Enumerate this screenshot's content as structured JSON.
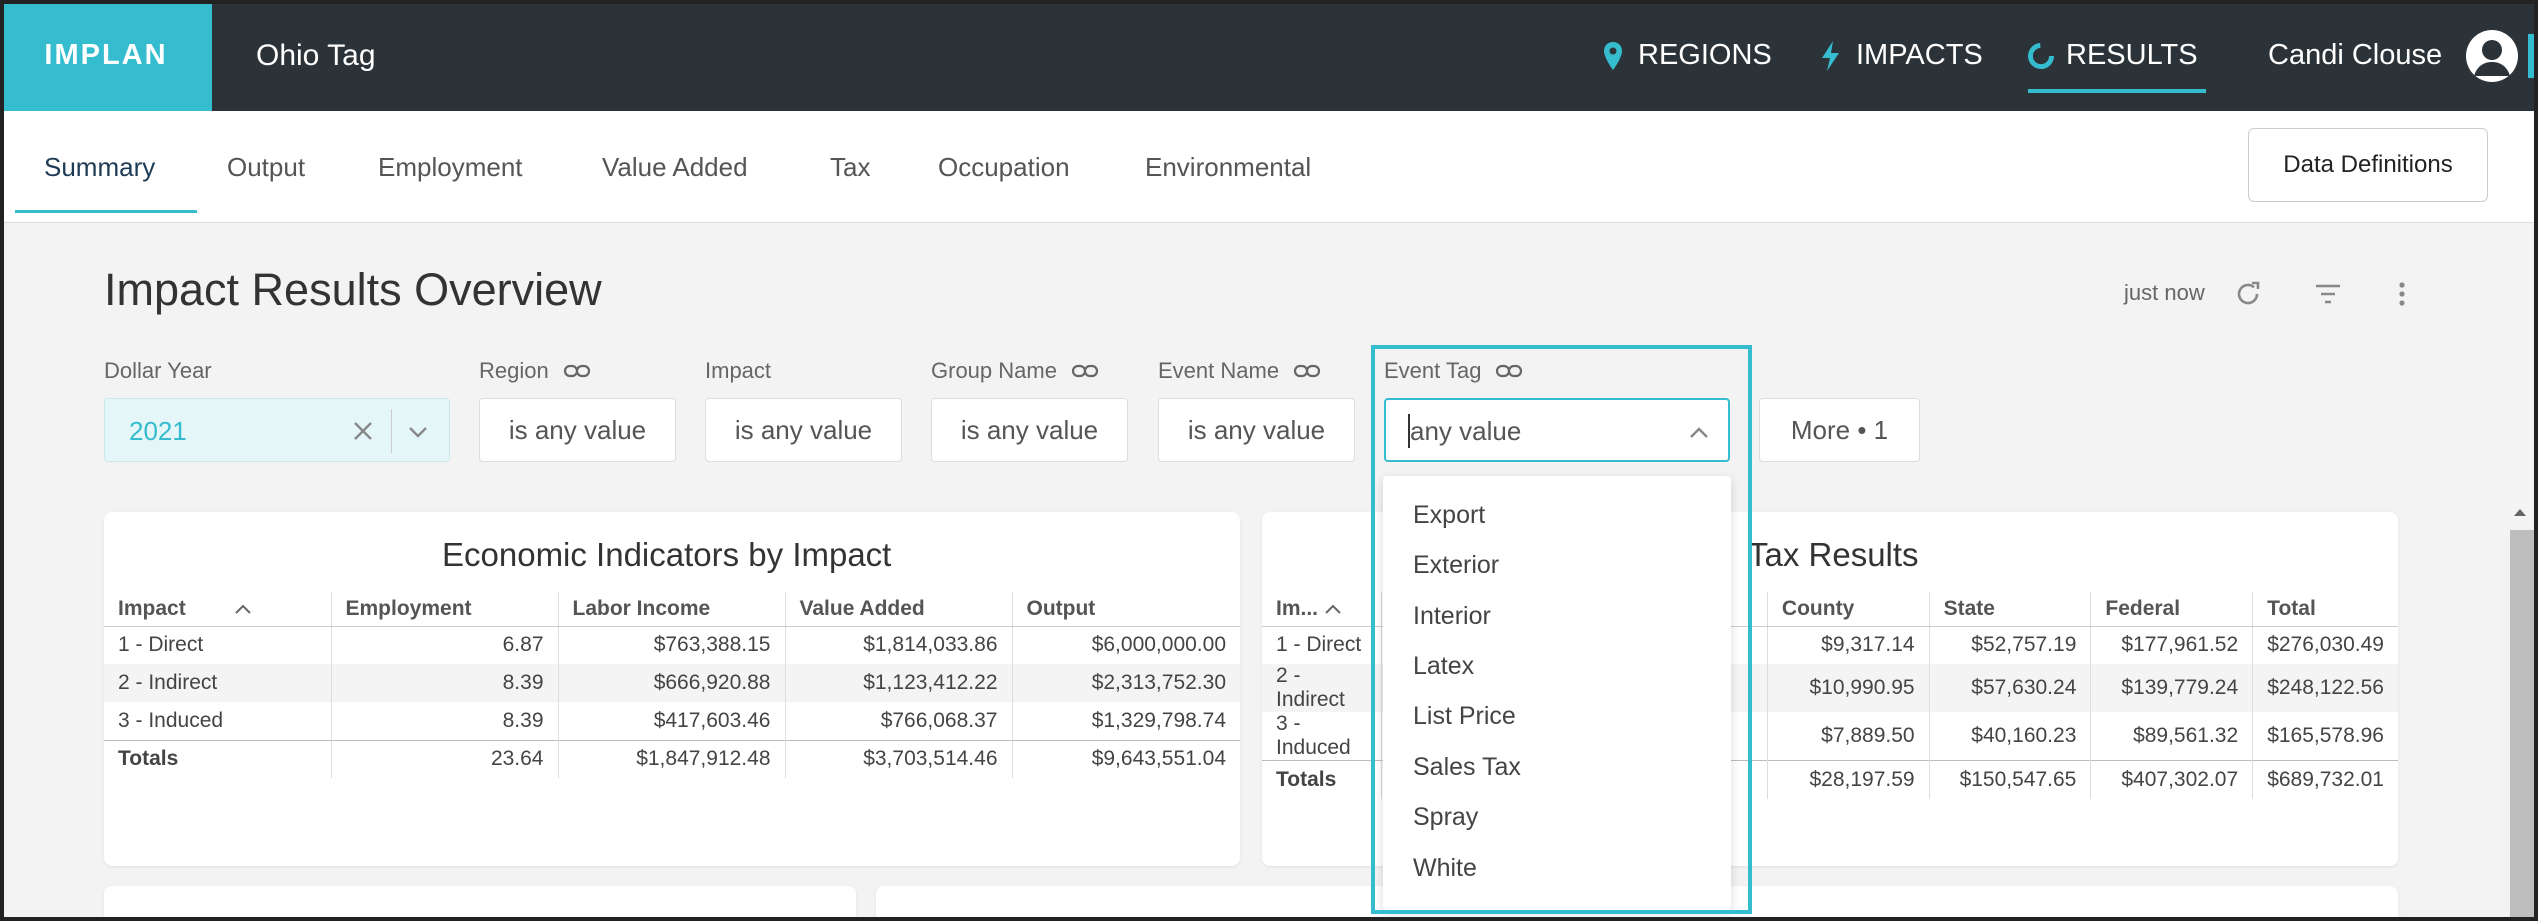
{
  "topbar": {
    "logo": "IMPLAN",
    "project": "Ohio Tag",
    "nav": [
      {
        "label": "REGIONS",
        "icon": "map-pin-icon"
      },
      {
        "label": "IMPACTS",
        "icon": "lightning-icon"
      },
      {
        "label": "RESULTS",
        "icon": "results-icon"
      }
    ],
    "user": "Candi Clouse"
  },
  "tabs": [
    "Summary",
    "Output",
    "Employment",
    "Value Added",
    "Tax",
    "Occupation",
    "Environmental"
  ],
  "active_tab": "Summary",
  "data_definitions": "Data Definitions",
  "header": {
    "title": "Impact Results Overview",
    "updated": "just now"
  },
  "filters": {
    "dollar_year": {
      "label": "Dollar Year",
      "value": "2021"
    },
    "region": {
      "label": "Region",
      "value": "is any value"
    },
    "impact": {
      "label": "Impact",
      "value": "is any value"
    },
    "group_name": {
      "label": "Group Name",
      "value": "is any value"
    },
    "event_name": {
      "label": "Event Name",
      "value": "is any value"
    },
    "event_tag": {
      "label": "Event Tag",
      "value": "any value"
    },
    "more": "More • 1"
  },
  "event_tag_options": [
    "Export",
    "Exterior",
    "Interior",
    "Latex",
    "List Price",
    "Sales Tax",
    "Spray",
    "White"
  ],
  "economic": {
    "title": "Economic Indicators by Impact",
    "columns": [
      "Impact",
      "Employment",
      "Labor Income",
      "Value Added",
      "Output"
    ],
    "rows": [
      [
        "1 - Direct",
        "6.87",
        "$763,388.15",
        "$1,814,033.86",
        "$6,000,000.00"
      ],
      [
        "2 - Indirect",
        "8.39",
        "$666,920.88",
        "$1,123,412.22",
        "$2,313,752.30"
      ],
      [
        "3 - Induced",
        "8.39",
        "$417,603.46",
        "$766,068.37",
        "$1,329,798.74"
      ],
      [
        "Totals",
        "23.64",
        "$1,847,912.48",
        "$3,703,514.46",
        "$9,643,551.04"
      ]
    ]
  },
  "tax": {
    "title": "Tax Results",
    "columns": [
      "Im...",
      "County",
      "State",
      "Federal",
      "Total"
    ],
    "rows": [
      [
        "1 - Direct",
        "$9,317.14",
        "$52,757.19",
        "$177,961.52",
        "$276,030.49"
      ],
      [
        "2 - Indirect",
        "$10,990.95",
        "$57,630.24",
        "$139,779.24",
        "$248,122.56"
      ],
      [
        "3 - Induced",
        "$7,889.50",
        "$40,160.23",
        "$89,561.32",
        "$165,578.96"
      ],
      [
        "Totals",
        "$28,197.59",
        "$150,547.65",
        "$407,302.07",
        "$689,732.01"
      ]
    ]
  },
  "colors": {
    "accent": "#36bccf",
    "topbar": "#2c3338"
  }
}
